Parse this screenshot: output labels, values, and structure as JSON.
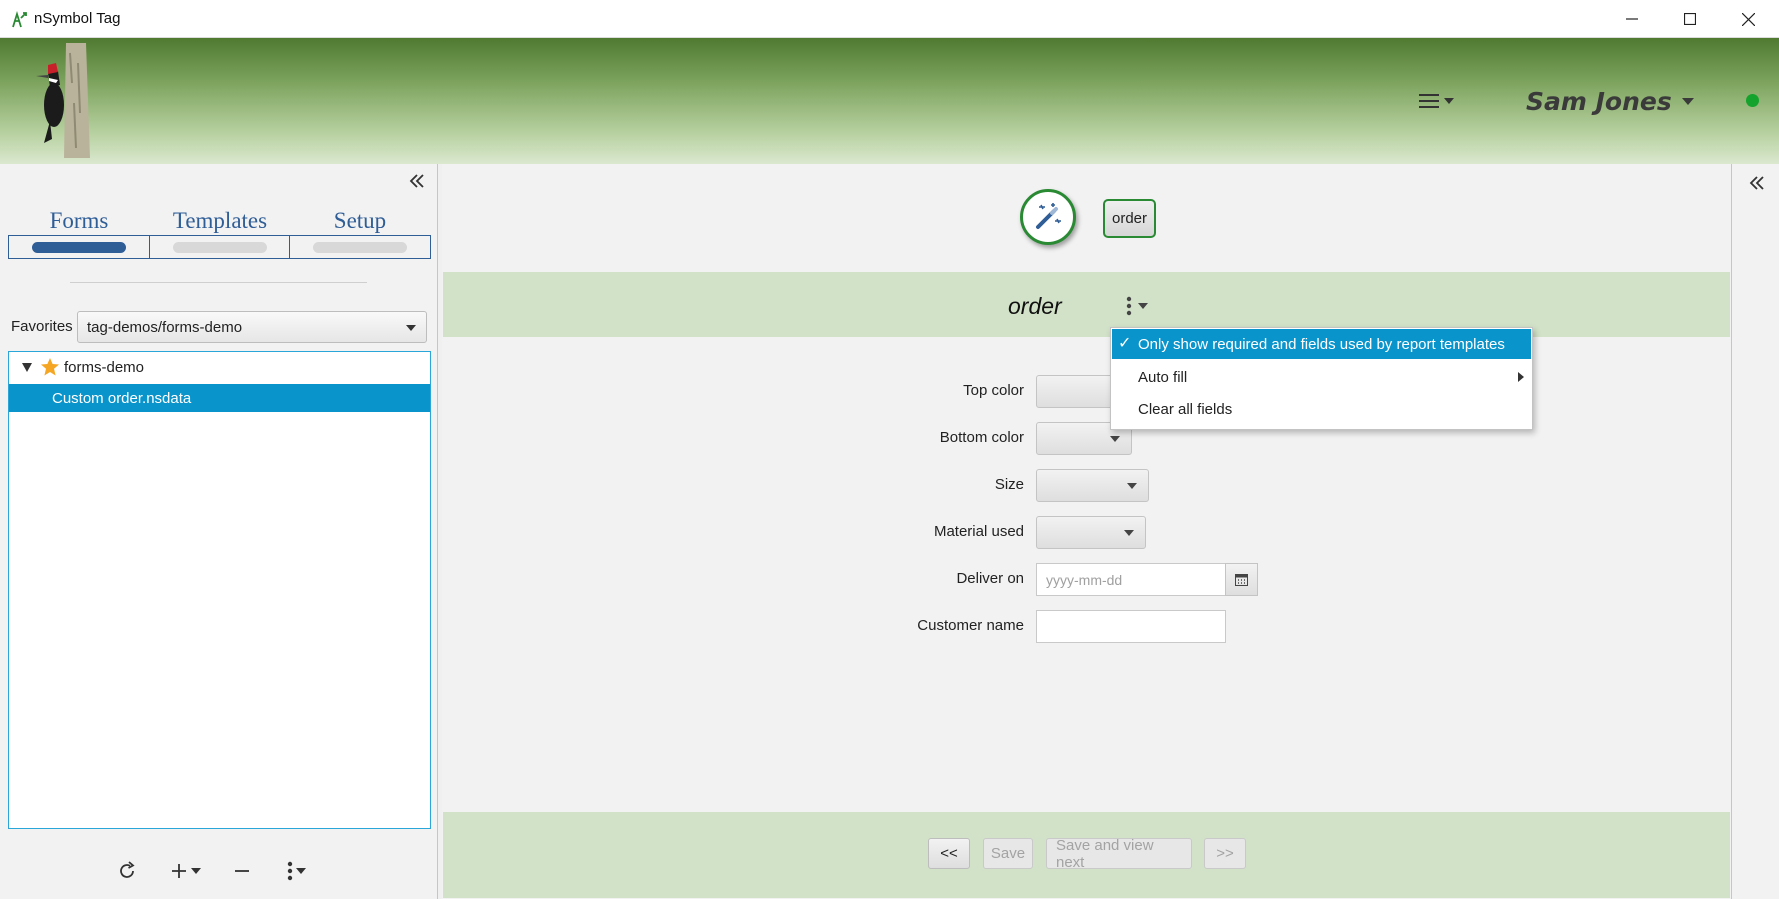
{
  "window": {
    "title": "nSymbol Tag"
  },
  "header": {
    "user_name": "Sam Jones"
  },
  "left_panel": {
    "tabs": [
      {
        "label": "Forms"
      },
      {
        "label": "Templates"
      },
      {
        "label": "Setup"
      }
    ],
    "active_tab": "Forms",
    "favorites_label": "Favorites",
    "favorites_value": "tag-demos/forms-demo",
    "tree": {
      "folder": "forms-demo",
      "selected_file": "Custom order.nsdata"
    }
  },
  "form": {
    "chip_label": "order",
    "title": "order",
    "fields": [
      {
        "label": "Top color"
      },
      {
        "label": "Bottom color"
      },
      {
        "label": "Size"
      },
      {
        "label": "Material used"
      },
      {
        "label": "Deliver on",
        "placeholder": "yyyy-mm-dd"
      },
      {
        "label": "Customer name"
      }
    ]
  },
  "menu": {
    "items": [
      {
        "label": "Only show required and fields used by report templates",
        "checked": true
      },
      {
        "label": "Auto fill"
      },
      {
        "label": "Clear all fields"
      }
    ]
  },
  "footer": {
    "prev_label": "<<",
    "save_label": "Save",
    "save_next_label": "Save and view next",
    "next_label": ">>"
  },
  "colors": {
    "accent_green": "#2a8a34",
    "selection_blue": "#0a94cc",
    "tab_blue": "#2f5d96",
    "status_online": "#14a32c"
  }
}
